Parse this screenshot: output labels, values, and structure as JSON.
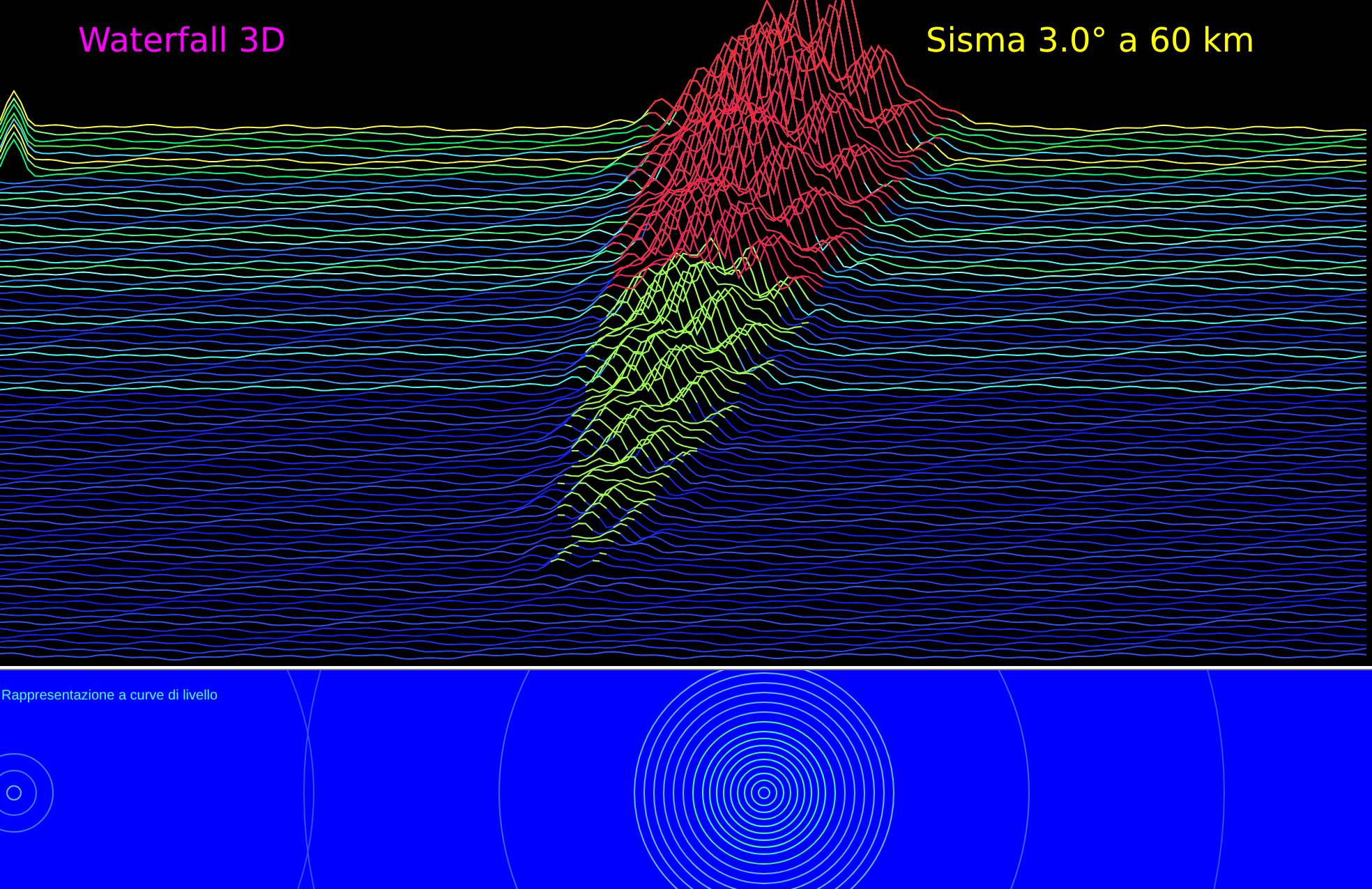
{
  "waterfall": {
    "title": "Waterfall 3D",
    "event_label": "Sisma 3.0° a 60 km"
  },
  "contour_panel": {
    "label": "Rappresentazione a curve di livello"
  }
}
